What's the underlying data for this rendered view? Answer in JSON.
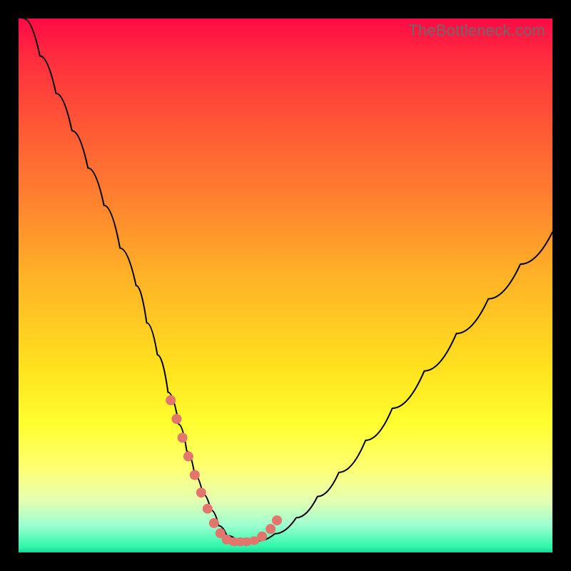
{
  "watermark": "TheBottleneck.com",
  "colors": {
    "background": "#000000",
    "curve": "#000000",
    "marker": "#e2766d",
    "gradient_top": "#ff0a45",
    "gradient_bottom": "#1ad49a"
  },
  "chart_data": {
    "type": "line",
    "title": "",
    "xlabel": "",
    "ylabel": "",
    "xlim": [
      0,
      100
    ],
    "ylim": [
      0,
      100
    ],
    "series": [
      {
        "name": "bottleneck-curve",
        "x": [
          1,
          4,
          7,
          10,
          13,
          16,
          19,
          22,
          24,
          26,
          28,
          30,
          31.5,
          33,
          34.5,
          36,
          37.5,
          39,
          41,
          43,
          45,
          48,
          52,
          56,
          60,
          65,
          70,
          76,
          82,
          88,
          94,
          100
        ],
        "y": [
          100,
          93,
          86,
          79,
          72,
          65,
          57,
          50,
          43,
          37,
          30,
          24,
          19,
          14.5,
          11,
          8,
          5,
          3.2,
          2.2,
          2,
          2.2,
          3.5,
          6.5,
          10.5,
          15,
          21,
          27,
          34,
          41,
          47.5,
          54,
          60
        ]
      }
    ],
    "markers": {
      "name": "highlight-dots",
      "x": [
        28.5,
        29.6,
        30.7,
        31.8,
        33.0,
        34.2,
        35.4,
        36.6,
        37.8,
        39.0,
        40.2,
        41.4,
        42.6,
        44.0,
        45.6,
        47.2,
        48.4
      ],
      "y": [
        28.5,
        25.0,
        21.5,
        18.0,
        14.5,
        11.2,
        8.2,
        5.5,
        3.6,
        2.4,
        2.0,
        2.0,
        2.0,
        2.2,
        3.0,
        4.4,
        6.0
      ]
    }
  }
}
